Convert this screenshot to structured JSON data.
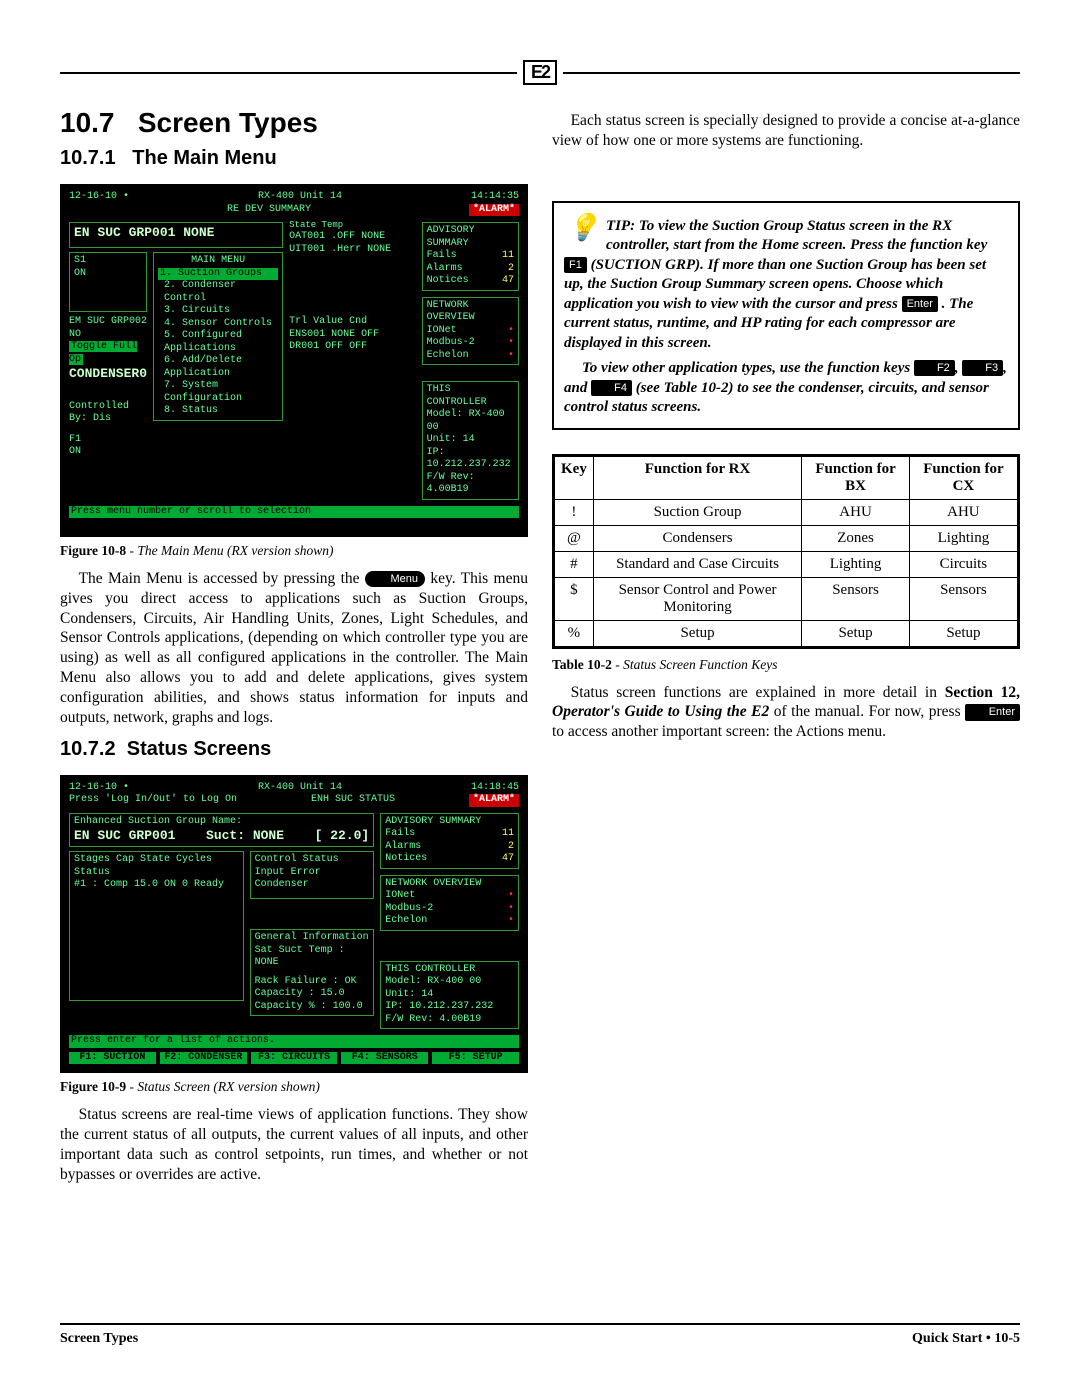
{
  "top_logo": "E2",
  "section": {
    "num": "10.7",
    "title": "Screen Types",
    "sub1_num": "10.7.1",
    "sub1_title": "The Main Menu",
    "sub2_num": "10.7.2",
    "sub2_title": "Status Screens"
  },
  "figure8": {
    "label": "Figure 10-8",
    "desc": " - The Main Menu (RX version shown)",
    "hdr_left": "12-16-10 •",
    "hdr_center": "RX-400 Unit 14",
    "hdr_center2": "RE DEV SUMMARY",
    "hdr_right": "14:14:35",
    "alarm": "*ALARM*",
    "title_line": "EN  SUC  GRP001   NONE",
    "state_temp": "State Temp",
    "oat_none": "OAT001  .OFF   NONE",
    "uit_none": "UIT001 .Herr NONE",
    "adv_title": "ADVISORY SUMMARY",
    "adv_fails": "Fails",
    "adv_alarms": "Alarms",
    "adv_notices": "Notices",
    "adv_fails_v": "11",
    "adv_alarms_v": "2",
    "adv_notices_v": "47",
    "main_menu_label": "MAIN MENU",
    "s1": "S1",
    "on": "ON",
    "menu": {
      "m1": "1.  Suction Groups",
      "m2": "2.  Condenser Control",
      "m3": "3.  Circuits",
      "m4": "4.  Sensor Controls",
      "m5": "5.  Configured Applications",
      "m6": "6.  Add/Delete Application",
      "m7": "7.  System Configuration",
      "m8": "8.  Status"
    },
    "net_title": "NETWORK OVERVIEW",
    "net_l1": "IONet",
    "net_l2": "Modbus-2",
    "net_l3": "Echelon",
    "side_left_a": "EM SUC GRP002    NO",
    "side_left_b": "Toggle Full Op",
    "side_left_c": "CONDENSER0",
    "side_left_d": "Controlled By: Dis",
    "side_left_e": "F1",
    "side_left_f": "ON",
    "tbl_hdr": "Trl   Value   Cnd",
    "tbl_l1": "ENS001 NONE    OFF",
    "tbl_l2": "DR001   OFF    OFF",
    "ctrl_title": "THIS CONTROLLER",
    "ctrl_l1": "Model: RX-400   00",
    "ctrl_l2": "Unit: 14",
    "ctrl_l3": "IP: 10.212.237.232",
    "ctrl_l4": "F/W Rev: 4.00B19",
    "footer_hint": "Press menu number or scroll to selection"
  },
  "para_main_a": "The Main Menu is accessed by pressing the ",
  "key_menu": "Menu",
  "para_main_b": " key. This menu gives you direct access to applications such as Suction Groups, Condensers, Circuits, Air Handling Units, Zones, Light Schedules, and Sensor Controls applications, (depending on which controller type you are using) as well as all configured applications in the controller. The Main Menu also allows you to add and delete applications, gives system configuration abilities, and shows status information for inputs and outputs, network, graphs and logs.",
  "figure9": {
    "label": "Figure 10-9",
    "desc": " - Status Screen (RX version shown)",
    "hdr_left": "12-16-10 •",
    "hdr_hint": "Press 'Log In/Out' to Log On",
    "hdr_center": "RX-400 Unit 14",
    "hdr_center2": "ENH SUC STATUS",
    "hdr_right": "14:18:45",
    "alarm": "*ALARM*",
    "group_label": "Enhanced Suction Group Name:",
    "group_name": "EN SUC GRP001",
    "suct_label": "Suct: NONE",
    "suct_val": "[   22.0]",
    "adv_title": "ADVISORY SUMMARY",
    "adv_fails": "Fails",
    "adv_alarms": "Alarms",
    "adv_notices": "Notices",
    "adv_fails_v": "11",
    "adv_alarms_v": "2",
    "adv_notices_v": "47",
    "stg_hdr": "Stages   Cap   State   Cycles  Status",
    "stg_row": "#1 : Comp  15.0   ON       0    Ready",
    "ctrl_status": "Control Status",
    "ctrl_status_l1": "Input Error",
    "ctrl_status_l2": "Condenser",
    "net_title": "NETWORK OVERVIEW",
    "net_l1": "IONet",
    "net_l2": "Modbus-2",
    "net_l3": "Echelon",
    "gen_title": "General Information",
    "gen_l1": "Sat Suct Temp : NONE",
    "gen_l2": "Rack Failure  :   OK",
    "gen_l3": "Capacity      :  15.0",
    "gen_l4": "Capacity %    : 100.0",
    "ctrl_title": "THIS CONTROLLER",
    "ctrl_l1": "Model: RX-400   00",
    "ctrl_l2": "Unit: 14",
    "ctrl_l3": "IP: 10.212.237.232",
    "ctrl_l4": "F/W Rev: 4.00B19",
    "foot_hint": "Press enter for a list of actions.",
    "f1": "F1: SUCTION",
    "f2": "F2: CONDENSER",
    "f3": "F3: CIRCUITS",
    "f4": "F4: SENSORS",
    "f5": "F5: SETUP"
  },
  "para_status": "Status screens are real-time views of application functions. They show the current status of all outputs, the current values of all inputs, and other important data such as control setpoints, run times, and whether or not bypasses or overrides are active.",
  "para_right_intro": "Each status screen is specially designed to provide a concise at-a-glance view of how one or more systems are functioning.",
  "tip": {
    "lead": "TIP: To view the Suction Group Status screen in the RX controller, start from the Home screen. Press the function key ",
    "f1": "F1",
    "after_f1": " (SUCTION GRP). If more than one Suction Group has been set up, the Suction Group Summary screen opens. Choose which application you wish to view with the cursor and press ",
    "enter": "Enter",
    "after_enter": ". The current status, runtime, and HP rating for each compressor are displayed in this screen.",
    "p2a": "To view other application types, use the function keys ",
    "f2": "F2",
    "comma1": ", ",
    "f3": "F3",
    "comma2": ", and ",
    "f4": "F4",
    "p2b": " (see Table 10-2) to see the condenser, circuits, and sensor control status screens."
  },
  "table": {
    "caption_label": "Table 10-2",
    "caption_desc": " - Status Screen Function Keys",
    "headers": {
      "h1": "Key",
      "h2": "Function for RX",
      "h3": "Function for BX",
      "h4": "Function for CX"
    },
    "rows": [
      {
        "k": "!",
        "rx": "Suction Group",
        "bx": "AHU",
        "cx": "AHU"
      },
      {
        "k": "@",
        "rx": "Condensers",
        "bx": "Zones",
        "cx": "Lighting"
      },
      {
        "k": "#",
        "rx": "Standard and Case Circuits",
        "bx": "Lighting",
        "cx": "Circuits"
      },
      {
        "k": "$",
        "rx": "Sensor Control and Power Monitoring",
        "bx": "Sensors",
        "cx": "Sensors"
      },
      {
        "k": "%",
        "rx": "Setup",
        "bx": "Setup",
        "cx": "Setup"
      }
    ]
  },
  "para_after_table_a": "Status screen functions are explained in more detail in ",
  "para_after_table_ref": "Section 12, ",
  "para_after_table_ref_i": "Operator's Guide to Using the E2",
  "para_after_table_b": " of the manual. For now, press ",
  "para_after_table_c": " to access another important screen: the Actions menu.",
  "key_enter": "Enter",
  "footer": {
    "left": "Screen Types",
    "right": "Quick Start • 10-5"
  }
}
